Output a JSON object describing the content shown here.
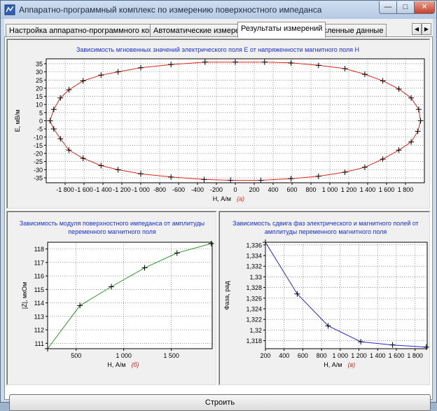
{
  "window": {
    "title": "Аппаратно-программный комплекс по измерению поверхностного импеданса",
    "minimize_symbol": "—",
    "maximize_symbol": "□",
    "close_symbol": "✕"
  },
  "tabs": [
    {
      "label": "Настройка аппаратно-программного комплекса",
      "active": false
    },
    {
      "label": "Автоматические измерения",
      "active": false
    },
    {
      "label": "Результаты измерений",
      "active": true
    },
    {
      "label": "Численные данные",
      "active": false
    }
  ],
  "tab_scroll": {
    "left": "◀",
    "right": "▶"
  },
  "build_button": {
    "label": "Строить"
  },
  "colors": {
    "top_series": "#e0241c",
    "bottom_left_series": "#2a9a2a",
    "bottom_right_series": "#2424d8",
    "title": "#1a2fd8",
    "letter": "#e0241c"
  },
  "chart_data": [
    {
      "type": "line",
      "title": "Зависимость мгновенных значений электрического поля E от напряженности магнитного поля H",
      "xlabel": "H, А/м",
      "xlabel_letter": "(а)",
      "ylabel": "E, мВ/м",
      "xlim": [
        -2000,
        2000
      ],
      "ylim": [
        -38,
        38
      ],
      "xticks": [
        -1800,
        -1600,
        -1400,
        -1200,
        -1000,
        -800,
        -600,
        -400,
        -200,
        0,
        200,
        400,
        600,
        800,
        1000,
        1200,
        1400,
        1600,
        1800
      ],
      "xtick_labels": [
        "-1 800",
        "-1 600",
        "-1 400",
        "-1 200",
        "-1 000",
        "-800",
        "-600",
        "-400",
        "-200",
        "0",
        "200",
        "400",
        "600",
        "800",
        "1 000",
        "1 200",
        "1 400",
        "1 600",
        "1 800"
      ],
      "yticks": [
        -35,
        -30,
        -25,
        -20,
        -15,
        -10,
        -5,
        0,
        5,
        10,
        15,
        20,
        25,
        30,
        35
      ],
      "grid": true,
      "closed": true,
      "series": [
        {
          "x": [
            -1960,
            -1920,
            -1850,
            -1760,
            -1610,
            -1420,
            -1240,
            -1000,
            -680,
            -320,
            0,
            310,
            590,
            880,
            1160,
            1370,
            1560,
            1730,
            1860,
            1940,
            1960,
            1930,
            1860,
            1730,
            1560,
            1370,
            1160,
            880,
            590,
            270,
            -50,
            -330,
            -680,
            -1000,
            -1240,
            -1420,
            -1610,
            -1760,
            -1850,
            -1920
          ],
          "y": [
            0,
            7,
            14,
            19,
            24.5,
            28,
            30,
            32.5,
            34.5,
            36,
            36,
            36,
            35.5,
            34,
            32,
            28.5,
            24.5,
            19.5,
            14,
            7,
            0,
            -6.5,
            -13,
            -18,
            -23.5,
            -28.5,
            -31.5,
            -34,
            -35.5,
            -36.5,
            -36.5,
            -36,
            -34.5,
            -32.5,
            -30,
            -27.5,
            -23,
            -18,
            -11,
            -5
          ]
        }
      ]
    },
    {
      "type": "line",
      "title": "Зависимость модуля поверхностного импеданса от амплитуды переменного магнитного поля",
      "xlabel": "H, А/м",
      "xlabel_letter": "(б)",
      "ylabel": "|Z|, мкОм",
      "xlim": [
        200,
        1930
      ],
      "ylim": [
        110.6,
        118.5
      ],
      "xticks": [
        500,
        1000,
        1500
      ],
      "xtick_labels": [
        "500",
        "1 000",
        "1 500"
      ],
      "yticks": [
        111,
        112,
        113,
        114,
        115,
        116,
        117,
        118
      ],
      "grid": true,
      "series": [
        {
          "x": [
            200,
            540,
            870,
            1220,
            1560,
            1920
          ],
          "y": [
            110.6,
            113.8,
            115.2,
            116.6,
            117.7,
            118.4
          ]
        }
      ]
    },
    {
      "type": "line",
      "title": "Зависимость сдвига фаз электрического и магнитного полей от амплитуды переменного магнитного поля",
      "xlabel": "H, А/м",
      "xlabel_letter": "(в)",
      "ylabel": "Фаза, рад",
      "xlim": [
        200,
        1930
      ],
      "ylim": [
        1.3165,
        1.3365
      ],
      "xticks": [
        200,
        400,
        600,
        800,
        1000,
        1200,
        1400,
        1600,
        1800
      ],
      "xtick_labels": [
        "200",
        "400",
        "600",
        "800",
        "1 000",
        "1 200",
        "1 400",
        "1 600",
        "1 800"
      ],
      "yticks": [
        1.318,
        1.32,
        1.322,
        1.324,
        1.326,
        1.328,
        1.33,
        1.332,
        1.334,
        1.336
      ],
      "ytick_labels": [
        "1,318",
        "1,32",
        "1,322",
        "1,324",
        "1,326",
        "1,328",
        "1,33",
        "1,332",
        "1,334",
        "1,336"
      ],
      "grid": true,
      "series": [
        {
          "x": [
            200,
            540,
            870,
            1220,
            1560,
            1920
          ],
          "y": [
            1.3365,
            1.3268,
            1.3208,
            1.3178,
            1.3172,
            1.3168
          ]
        }
      ]
    }
  ]
}
